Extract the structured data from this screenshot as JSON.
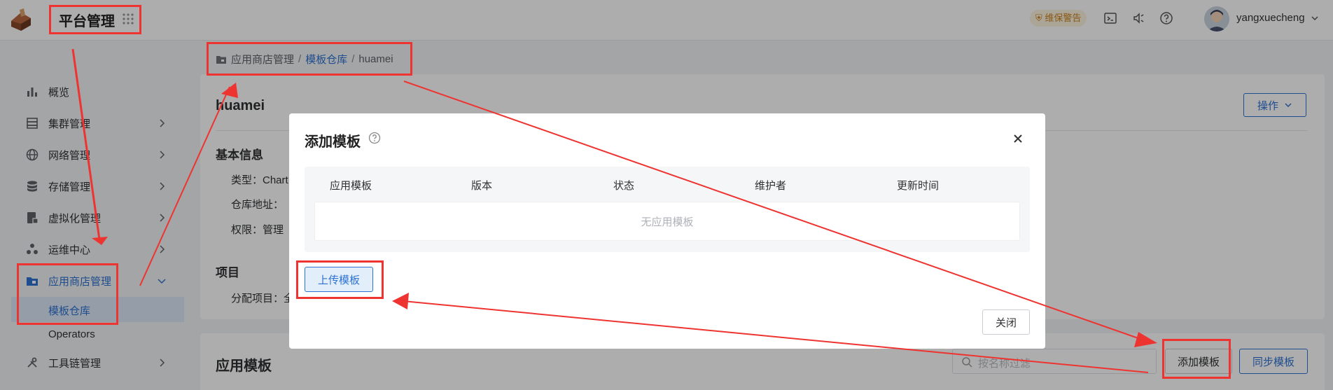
{
  "header": {
    "platform_title": "平台管理",
    "warning_badge": "维保警告",
    "username": "yangxuecheng",
    "icons": [
      "grid-icon",
      "shield-icon",
      "terminal-icon",
      "speaker-icon",
      "help-icon",
      "avatar",
      "chevron-down-icon"
    ]
  },
  "sidebar": {
    "items": [
      {
        "label": "概览",
        "icon": "bar-chart-icon",
        "has_chevron": false
      },
      {
        "label": "集群管理",
        "icon": "server-icon",
        "has_chevron": true
      },
      {
        "label": "网络管理",
        "icon": "globe-icon",
        "has_chevron": true
      },
      {
        "label": "存储管理",
        "icon": "database-icon",
        "has_chevron": true
      },
      {
        "label": "虚拟化管理",
        "icon": "vm-icon",
        "has_chevron": true
      },
      {
        "label": "运维中心",
        "icon": "ops-icon",
        "has_chevron": true
      },
      {
        "label": "应用商店管理",
        "icon": "store-icon",
        "has_chevron": true,
        "expanded": true
      },
      {
        "label": "工具链管理",
        "icon": "tools-icon",
        "has_chevron": true
      }
    ],
    "sub_items": [
      {
        "label": "模板仓库",
        "active": true
      },
      {
        "label": "Operators",
        "active": false
      }
    ]
  },
  "breadcrumb": {
    "root": "应用商店管理",
    "sep": "/",
    "middle": "模板仓库",
    "current": "huamei"
  },
  "detail": {
    "title": "huamei",
    "operate_label": "操作",
    "basic_info_title": "基本信息",
    "type_label": "类型：Chart",
    "repo_label": "仓库地址：",
    "perm_label": "权限：管理",
    "project_title": "项目",
    "assign_label": "分配项目：全"
  },
  "templates_section": {
    "title": "应用模板",
    "search_placeholder": "按名称过滤",
    "add_label": "添加模板",
    "sync_label": "同步模板"
  },
  "modal": {
    "title": "添加模板",
    "columns": [
      "应用模板",
      "版本",
      "状态",
      "维护者",
      "更新时间"
    ],
    "empty_text": "无应用模板",
    "upload_label": "上传模板",
    "close_label": "关闭"
  },
  "colors": {
    "accent": "#2e72d2",
    "annotation": "#ee3431",
    "warning": "#c9811b"
  }
}
